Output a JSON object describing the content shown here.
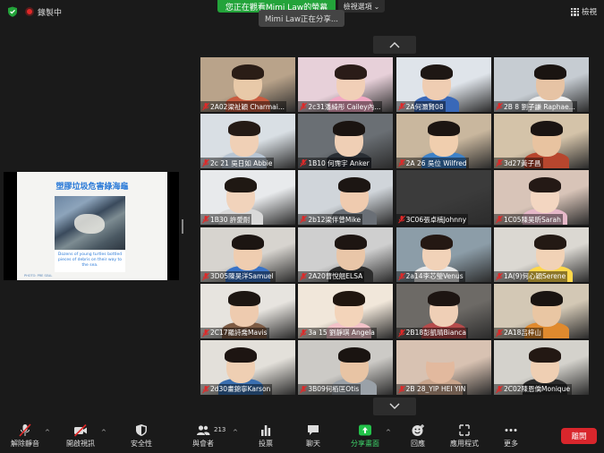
{
  "topbar": {
    "recording_label": "錄製中",
    "viewing_banner": "您正在觀看Mimi Law的螢幕",
    "view_options_label": "檢視選項",
    "sharing_tooltip": "Mimi Law正在分享...",
    "view_mode_label": "檢視"
  },
  "shared_screen": {
    "slide_title": "塑膠垃圾危害綠海龜",
    "caption": "Dozens of young turtles bottled pieces of debris on their way to the sea.",
    "footer": "PHOTO: PRE SEAL"
  },
  "participants": [
    {
      "name": "2A02梁祉穎 Charmai...",
      "colors": [
        "#b9a38a",
        "#e8c9a8",
        "#2a1d16",
        "#c95b3f"
      ]
    },
    {
      "name": "2c31潘綺彤 Cailey內...",
      "colors": [
        "#e7d0d9",
        "#f1cfb7",
        "#2a1c18",
        "#f2a8c4"
      ]
    },
    {
      "name": "2A何灝賢08",
      "colors": [
        "#dfe4ea",
        "#efcdb2",
        "#1e1714",
        "#3968b8"
      ]
    },
    {
      "name": "2B 8 劉子謙 Raphae...",
      "colors": [
        "#c6ccd2",
        "#e6c3a4",
        "#1a1411",
        "#f0f0f0"
      ]
    },
    {
      "name": "2c 21 吳日如 Abbie",
      "colors": [
        "#d9dfe4",
        "#f0d0b6",
        "#241a15",
        "#b8c5d3"
      ]
    },
    {
      "name": "1B10 何霈宇 Anker",
      "colors": [
        "#6a6f74",
        "#efcfb5",
        "#1a1411",
        "#2a2f35"
      ]
    },
    {
      "name": "2A 26 吳位 Wilfred",
      "colors": [
        "#c9b79e",
        "#f0ceae",
        "#1c1512",
        "#3e82c8"
      ]
    },
    {
      "name": "3d27黃子昌",
      "colors": [
        "#d4c3a9",
        "#e8c3a0",
        "#1b1412",
        "#b7462e"
      ]
    },
    {
      "name": "1B30 許愛耐",
      "colors": [
        "#e8eaec",
        "#f1d3bb",
        "#1f1813",
        "#d9d9d9"
      ]
    },
    {
      "name": "2b12梁伴曾Mike",
      "colors": [
        "#d0d5da",
        "#efcbaf",
        "#1c1613",
        "#6a6f76"
      ]
    },
    {
      "name": "3C06張卓楠Johnny",
      "colors": [
        "#3b3b3b",
        "#3b3b3b",
        "#3b3b3b",
        "#3b3b3b"
      ]
    },
    {
      "name": "1C05陳昊昕Sarah",
      "colors": [
        "#d8c4b8",
        "#f3d6c1",
        "#241915",
        "#e6b8c8"
      ]
    },
    {
      "name": "3D05陳昊洋Samuel",
      "colors": [
        "#d7d4cf",
        "#efcdb0",
        "#1c1512",
        "#3973c7"
      ]
    },
    {
      "name": "2A20曹悅翹ELSA",
      "colors": [
        "#cfcfcf",
        "#e9c6a8",
        "#1d1512",
        "#2c2c2c"
      ]
    },
    {
      "name": "2a14李芯瑩Venus",
      "colors": [
        "#8c9da8",
        "#f1d2b8",
        "#241813",
        "#e8e8e8"
      ]
    },
    {
      "name": "1A(9)何心穎Serene",
      "colors": [
        "#dbd8d2",
        "#f1d2b6",
        "#231914",
        "#ffd84a"
      ]
    },
    {
      "name": "2C17羅詩喬Mavis",
      "colors": [
        "#e7e4df",
        "#eecbaf",
        "#1d1612",
        "#7e5c45"
      ]
    },
    {
      "name": "3a 15 劉靜琪 Angela",
      "colors": [
        "#f1e7da",
        "#f3d4ba",
        "#20160f",
        "#f2c2c8"
      ]
    },
    {
      "name": "2B18彭凱晴Bianca",
      "colors": [
        "#6d6a66",
        "#efcfb6",
        "#1d1512",
        "#b54b4b"
      ]
    },
    {
      "name": "2A18吕梓山",
      "colors": [
        "#d3c8b5",
        "#e9c6a3",
        "#1a1411",
        "#e08a2e"
      ]
    },
    {
      "name": "2d30畫錦寧Karson",
      "colors": [
        "#e3e0da",
        "#efcfb3",
        "#1d1512",
        "#3a6fb0"
      ]
    },
    {
      "name": "3B09何栢匡Otis",
      "colors": [
        "#cccac6",
        "#e8c4a4",
        "#1a1411",
        "#9aa1a8"
      ]
    },
    {
      "name": "2B 28_YIP HEI YIN",
      "colors": [
        "#d8c2b2",
        "#e2b99e",
        "#d8c2b2",
        "#c9a58c"
      ]
    },
    {
      "name": "2C02陳恩僑Monique",
      "colors": [
        "#d4d2cc",
        "#efcfb3",
        "#231813",
        "#2b2b2b"
      ]
    }
  ],
  "toolbar": {
    "unmute": "解除靜音",
    "start_video": "開啟視訊",
    "security": "安全性",
    "participants": "與會者",
    "participant_count": "213",
    "polls": "投票",
    "chat": "聊天",
    "share_screen": "分享畫面",
    "reactions": "回應",
    "apps": "應用程式",
    "more": "更多",
    "leave": "離開"
  },
  "colors": {
    "banner_green": "#23a33a",
    "leave_red": "#d9262c",
    "mute_red": "#e02828",
    "share_green": "#23c24a"
  }
}
